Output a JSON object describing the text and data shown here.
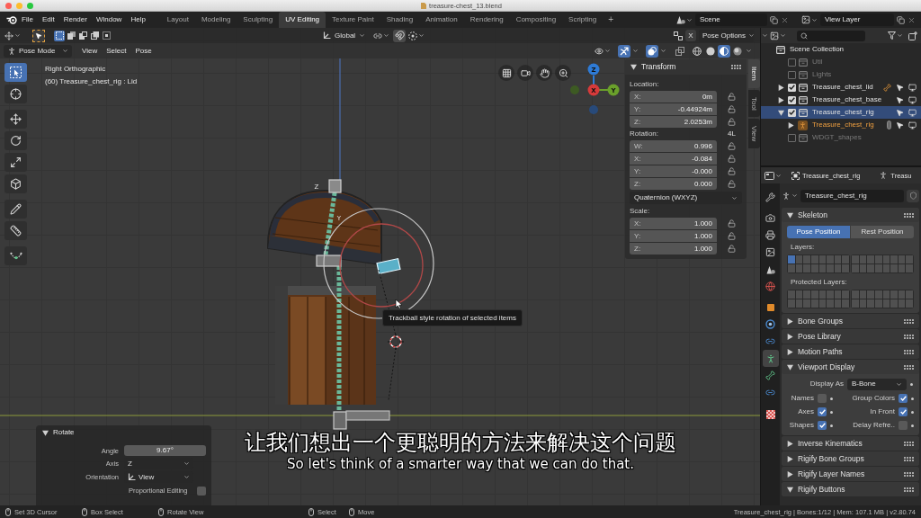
{
  "window": {
    "title": "treasure-chest_13.blend"
  },
  "menu": [
    "File",
    "Edit",
    "Render",
    "Window",
    "Help"
  ],
  "workspaces": [
    {
      "label": "Layout",
      "selected": false
    },
    {
      "label": "Modeling",
      "selected": false
    },
    {
      "label": "Sculpting",
      "selected": false
    },
    {
      "label": "UV Editing",
      "selected": true
    },
    {
      "label": "Texture Paint",
      "selected": false
    },
    {
      "label": "Shading",
      "selected": false
    },
    {
      "label": "Animation",
      "selected": false
    },
    {
      "label": "Rendering",
      "selected": false
    },
    {
      "label": "Compositing",
      "selected": false
    },
    {
      "label": "Scripting",
      "selected": false
    }
  ],
  "add_workspace": "+",
  "scene": {
    "value": "Scene"
  },
  "view_layer": {
    "value": "View Layer"
  },
  "viewport": {
    "select_modes": [
      {
        "selected": true
      },
      {
        "selected": false
      },
      {
        "selected": false
      },
      {
        "selected": false
      },
      {
        "selected": false
      }
    ],
    "orientation": "Global",
    "x_mirror": {
      "label": "X",
      "on": false
    },
    "pose_options": "Pose Options",
    "mode": "Pose Mode",
    "menus": [
      "View",
      "Select",
      "Pose"
    ],
    "gizmos": {
      "on": true
    },
    "overlays": {
      "on": true
    },
    "xray": {
      "on": false
    },
    "shading": [
      {
        "selected": false
      },
      {
        "selected": false
      },
      {
        "selected": true
      },
      {
        "selected": false
      }
    ],
    "tools": [
      {
        "selected": true
      },
      {
        "selected": false
      },
      {
        "selected": false
      },
      {
        "selected": false
      },
      {
        "selected": false
      },
      {
        "selected": false
      },
      {
        "selected": false
      },
      {
        "selected": false
      },
      {
        "selected": false
      }
    ],
    "view_name": "Right Orthographic",
    "object_info": "(60) Treasure_chest_rig : Lid",
    "axis_gizmo": [
      "Z",
      "X",
      "Y"
    ],
    "bone_axis_labels": [
      "Z",
      "Y"
    ],
    "tooltip": "Trackball style rotation of selected items"
  },
  "operator": {
    "title": "Rotate",
    "expanded": true,
    "rows": [
      {
        "kind": "number",
        "label": "Angle",
        "value": "9.67°"
      },
      {
        "kind": "dropdown",
        "label": "Axis",
        "value": "Z"
      },
      {
        "kind": "dropdown_icon",
        "label": "Orientation",
        "value": "View"
      },
      {
        "kind": "checkbox",
        "label": "Proportional Editing",
        "checked": false
      }
    ]
  },
  "subtitles": [
    "让我们想出一个更聪明的方法来解决这个问题",
    "So let's think of a smarter way that we can do that."
  ],
  "sidebar": {
    "tabs": [
      {
        "label": "Item",
        "selected": true
      },
      {
        "label": "Tool",
        "selected": false
      },
      {
        "label": "View",
        "selected": false
      }
    ],
    "panel": {
      "title": "Transform",
      "expanded": true,
      "items": [
        {
          "kind": "vector",
          "label": "Location:",
          "fields": [
            {
              "axis": "X:",
              "value": "0m",
              "locked": false
            },
            {
              "axis": "Y:",
              "value": "-0.44924m",
              "locked": false
            },
            {
              "axis": "Z:",
              "value": "2.0253m",
              "locked": false
            }
          ]
        },
        {
          "kind": "vector",
          "label": "Rotation:",
          "lock_mode": "4L",
          "fields": [
            {
              "axis": "W:",
              "value": "0.996",
              "locked": false
            },
            {
              "axis": "X:",
              "value": "-0.084",
              "locked": false
            },
            {
              "axis": "Y:",
              "value": "-0.000",
              "locked": false
            },
            {
              "axis": "Z:",
              "value": "0.000",
              "locked": false
            }
          ]
        },
        {
          "kind": "dropdown",
          "value": "Quaternion (WXYZ)"
        },
        {
          "kind": "vector",
          "label": "Scale:",
          "fields": [
            {
              "axis": "X:",
              "value": "1.000",
              "locked": false
            },
            {
              "axis": "Y:",
              "value": "1.000",
              "locked": false
            },
            {
              "axis": "Z:",
              "value": "1.000",
              "locked": false
            }
          ]
        }
      ]
    }
  },
  "outliner": {
    "root": {
      "label": "Scene Collection",
      "children": [
        {
          "label": "Util",
          "checked": false,
          "expandable": false,
          "selected": false,
          "restrict_icons": false,
          "indicator": false
        },
        {
          "label": "Lights",
          "checked": false,
          "expandable": false,
          "selected": false,
          "restrict_icons": false,
          "indicator": false
        },
        {
          "label": "Treasure_chest_lid",
          "checked": true,
          "expandable": true,
          "expanded": false,
          "selected": false,
          "restrict_icons": true,
          "indicator": true
        },
        {
          "label": "Treasure_chest_base",
          "checked": true,
          "expandable": true,
          "expanded": false,
          "selected": false,
          "restrict_icons": true,
          "indicator": false
        },
        {
          "label": "Treasure_chest_rig",
          "checked": true,
          "expandable": true,
          "expanded": true,
          "selected": true,
          "restrict_icons": true,
          "indicator": false,
          "children": [
            {
              "label": "Treasure_chest_rig",
              "active": true,
              "expanded": false,
              "indicator": true
            }
          ]
        },
        {
          "label": "WDGT_shapes",
          "checked": false,
          "expandable": false,
          "selected": false,
          "restrict_icons": false,
          "indicator": false
        }
      ]
    }
  },
  "properties": {
    "header": {
      "object": "Treasure_chest_rig",
      "data": "Treasu"
    },
    "tabs": [
      {
        "selected": false
      },
      {
        "selected": false
      },
      {
        "selected": false
      },
      {
        "selected": false
      },
      {
        "selected": false
      },
      {
        "selected": false
      },
      {
        "selected": false
      },
      {
        "selected": false
      },
      {
        "selected": false
      },
      {
        "selected": true
      },
      {
        "selected": false
      },
      {
        "selected": false
      },
      {
        "selected": false
      }
    ],
    "datablock": "Treasure_chest_rig",
    "panels": [
      {
        "kind": "skeleton",
        "title": "Skeleton",
        "expanded": true,
        "positions": [
          {
            "label": "Pose Position",
            "selected": true
          },
          {
            "label": "Rest Position",
            "selected": false
          }
        ],
        "layers_label": "Layers:",
        "layers": [
          true,
          false,
          false,
          false,
          false,
          false,
          false,
          false,
          false,
          false,
          false,
          false,
          false,
          false,
          false,
          false,
          false,
          false,
          false,
          false,
          false,
          false,
          false,
          false,
          false,
          false,
          false,
          false,
          false,
          false,
          false,
          false
        ],
        "protected_label": "Protected Layers:",
        "protected_layers": [
          false,
          false,
          false,
          false,
          false,
          false,
          false,
          false,
          false,
          false,
          false,
          false,
          false,
          false,
          false,
          false,
          false,
          false,
          false,
          false,
          false,
          false,
          false,
          false,
          false,
          false,
          false,
          false,
          false,
          false,
          false,
          false
        ]
      },
      {
        "kind": "simple",
        "title": "Bone Groups",
        "expanded": false
      },
      {
        "kind": "simple",
        "title": "Pose Library",
        "expanded": false
      },
      {
        "kind": "simple",
        "title": "Motion Paths",
        "expanded": false
      },
      {
        "kind": "display",
        "title": "Viewport Display",
        "expanded": true,
        "display_as": {
          "label": "Display As",
          "value": "B-Bone"
        },
        "options": [
          {
            "label": "Names",
            "checked": false
          },
          {
            "label": "Group Colors",
            "checked": true
          },
          {
            "label": "Axes",
            "checked": true
          },
          {
            "label": "In Front",
            "checked": true
          },
          {
            "label": "Shapes",
            "checked": true
          },
          {
            "label": "Delay Refre..",
            "checked": false
          }
        ]
      },
      {
        "kind": "simple",
        "title": "Inverse Kinematics",
        "expanded": false
      },
      {
        "kind": "simple",
        "title": "Rigify Bone Groups",
        "expanded": false
      },
      {
        "kind": "simple",
        "title": "Rigify Layer Names",
        "expanded": false
      },
      {
        "kind": "simple",
        "title": "Rigify Buttons",
        "expanded": true
      }
    ]
  },
  "status_bar": {
    "left": [
      {
        "label": "Set 3D Cursor"
      },
      {
        "label": "Box Select"
      },
      {
        "label": "Rotate View"
      }
    ],
    "center": [
      {
        "label": "Select"
      },
      {
        "label": "Move"
      }
    ],
    "stats": "Treasure_chest_rig | Bones:1/12 | Mem: 107.1 MB | v2.80.74"
  }
}
